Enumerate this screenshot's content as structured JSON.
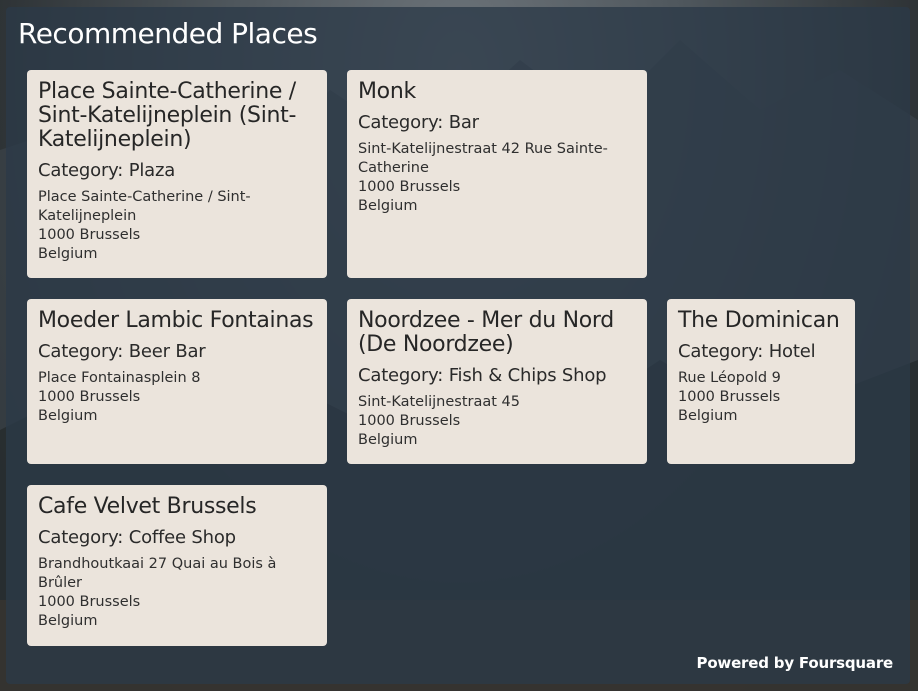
{
  "title": "Recommended Places",
  "category_prefix": "Category: ",
  "places": [
    {
      "name": "Place Sainte-Catherine / Sint-Katelijneplein (Sint-Katelijneplein)",
      "category": "Plaza",
      "address": [
        "Place Sainte-Catherine / Sint-Katelijneplein",
        "1000 Brussels",
        "Belgium"
      ]
    },
    {
      "name": "Monk",
      "category": "Bar",
      "address": [
        "Sint-Katelijnestraat 42 Rue Sainte-Catherine",
        "1000 Brussels",
        "Belgium"
      ]
    },
    {
      "name": "Moeder Lambic Fontainas",
      "category": "Beer Bar",
      "address": [
        "Place Fontainasplein 8",
        "1000 Brussels",
        "Belgium"
      ]
    },
    {
      "name": "Noordzee - Mer du Nord (De Noordzee)",
      "category": "Fish & Chips Shop",
      "address": [
        "Sint-Katelijnestraat 45",
        "1000 Brussels",
        "Belgium"
      ]
    },
    {
      "name": "The Dominican",
      "category": "Hotel",
      "address": [
        "Rue Léopold 9",
        "1000 Brussels",
        "Belgium"
      ]
    },
    {
      "name": "Cafe Velvet Brussels",
      "category": "Coffee Shop",
      "address": [
        "Brandhoutkaai 27 Quai au Bois à Brûler",
        "1000 Brussels",
        "Belgium"
      ]
    }
  ],
  "footer": "Powered by Foursquare"
}
